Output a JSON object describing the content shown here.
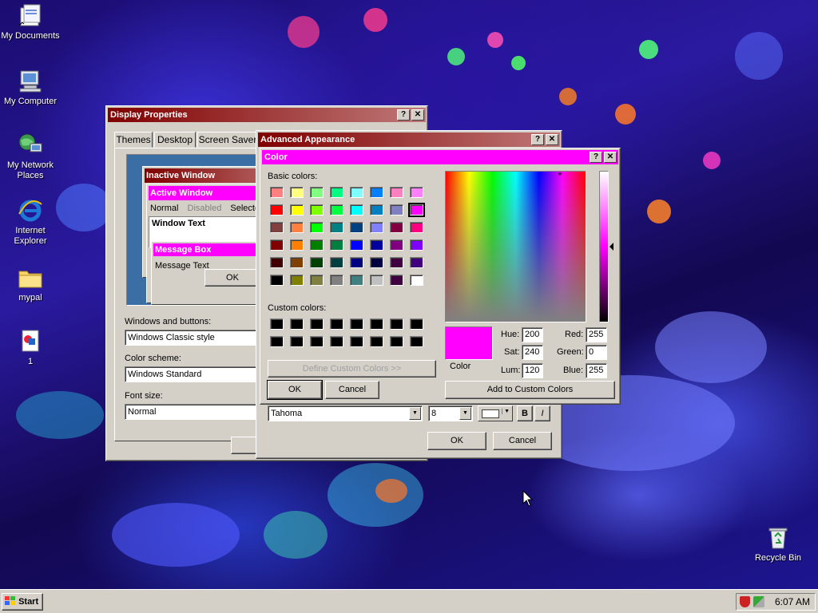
{
  "desktop": {
    "icons": [
      {
        "label": "My Documents"
      },
      {
        "label": "My Computer"
      },
      {
        "label": "My Network Places"
      },
      {
        "label": "Internet Explorer"
      },
      {
        "label": "mypal"
      },
      {
        "label": "1"
      },
      {
        "label": "Recycle Bin"
      }
    ]
  },
  "display_props": {
    "title": "Display Properties",
    "tabs": [
      "Themes",
      "Desktop",
      "Screen Saver"
    ],
    "preview": {
      "inactive_window": "Inactive Window",
      "active_window": "Active Window",
      "menu": [
        "Normal",
        "Disabled",
        "Selected"
      ],
      "window_text": "Window Text",
      "message_box": "Message Box",
      "message_text": "Message Text",
      "ok": "OK"
    },
    "windows_buttons_label": "Windows and buttons:",
    "windows_buttons_value": "Windows Classic style",
    "color_scheme_label": "Color scheme:",
    "color_scheme_value": "Windows Standard",
    "font_size_label": "Font size:",
    "font_size_value": "Normal"
  },
  "advanced": {
    "title": "Advanced Appearance",
    "font_value": "Tahoma",
    "size_value": "8",
    "bold": "B",
    "italic": "I",
    "ok": "OK",
    "cancel": "Cancel"
  },
  "color_dialog": {
    "title": "Color",
    "basic_colors_label": "Basic colors:",
    "custom_colors_label": "Custom colors:",
    "define_custom": "Define Custom Colors >>",
    "ok": "OK",
    "cancel": "Cancel",
    "color_label": "Color",
    "hue_label": "Hue:",
    "hue": "200",
    "sat_label": "Sat:",
    "sat": "240",
    "lum_label": "Lum:",
    "lum": "120",
    "red_label": "Red:",
    "red": "255",
    "green_label": "Green:",
    "green": "0",
    "blue_label": "Blue:",
    "blue": "255",
    "add_custom": "Add to Custom Colors",
    "selected_color": "#ff00ff",
    "basic_colors": [
      "#ff8080",
      "#ffff80",
      "#80ff80",
      "#00ff80",
      "#80ffff",
      "#0080ff",
      "#ff80c0",
      "#ff80ff",
      "#ff0000",
      "#ffff00",
      "#80ff00",
      "#00ff40",
      "#00ffff",
      "#0080c0",
      "#8080c0",
      "#ff00ff",
      "#804040",
      "#ff8040",
      "#00ff00",
      "#008080",
      "#004080",
      "#8080ff",
      "#800040",
      "#ff0080",
      "#800000",
      "#ff8000",
      "#008000",
      "#008040",
      "#0000ff",
      "#0000a0",
      "#800080",
      "#8000ff",
      "#400000",
      "#804000",
      "#004000",
      "#004040",
      "#000080",
      "#000040",
      "#400040",
      "#400080",
      "#000000",
      "#808000",
      "#808040",
      "#808080",
      "#408080",
      "#c0c0c0",
      "#400040",
      "#ffffff"
    ]
  },
  "taskbar": {
    "start": "Start",
    "clock": "6:07 AM"
  },
  "colors": {
    "active_title": "#ff00ff",
    "inactive_title": "#800000",
    "face": "#d4d0c8",
    "preview_bg": "#3a6ea5"
  }
}
